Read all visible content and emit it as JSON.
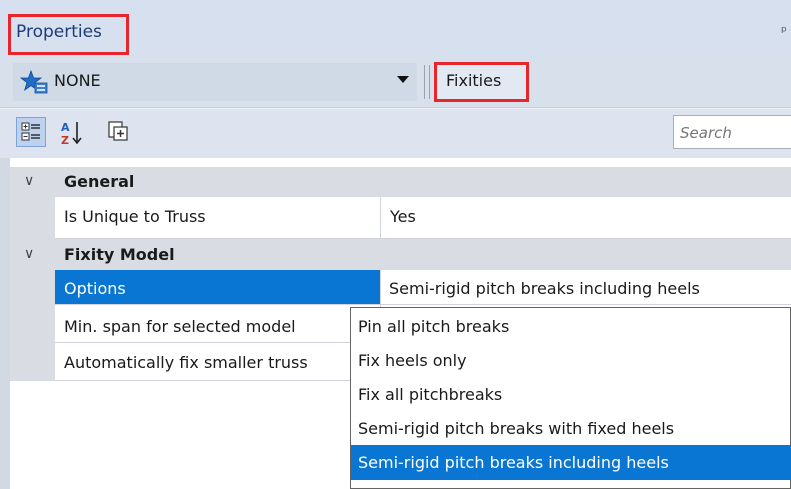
{
  "panel": {
    "title": "Properties",
    "pin_glyph": "ᵖ",
    "selector": {
      "object_type": "NONE",
      "object_icon": "star-icon",
      "context": "Fixities"
    },
    "toolbar": {
      "search_placeholder": "Search",
      "icons": [
        "categorized-icon",
        "alphabetical-sort-icon",
        "property-pages-icon"
      ]
    }
  },
  "grid": {
    "sections": [
      {
        "title": "General",
        "rows": [
          {
            "name": "Is Unique to Truss",
            "value": "Yes"
          }
        ]
      },
      {
        "title": "Fixity Model",
        "rows": [
          {
            "name": "Options",
            "value": "Semi-rigid pitch breaks including heels",
            "selected": true
          },
          {
            "name": "Min. span for selected model",
            "value": ""
          },
          {
            "name": "Automatically fix smaller truss",
            "value": ""
          }
        ]
      }
    ]
  },
  "dropdown": {
    "options": [
      "Pin all pitch breaks",
      "Fix heels only",
      "Fix all pitchbreaks",
      "Semi-rigid pitch breaks with fixed heels",
      "Semi-rigid pitch breaks including heels"
    ],
    "selected": "Semi-rigid pitch breaks including heels"
  },
  "colors": {
    "highlight": "#0a76d4",
    "annotation_frame": "#e8252b",
    "title_text": "#1d3b78"
  }
}
